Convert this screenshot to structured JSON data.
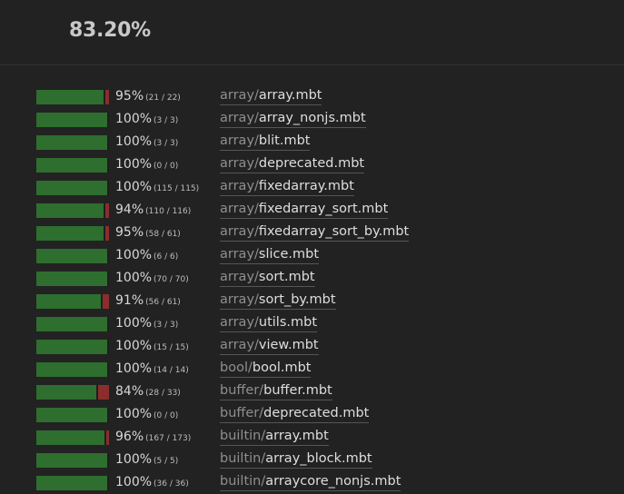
{
  "summary": {
    "total_coverage": "83.20%"
  },
  "colors": {
    "covered": "#2e6e2e",
    "uncovered": "#8b2d2d",
    "background": "#222222"
  },
  "files": [
    {
      "percent": "95%",
      "counts": "(21 / 22)",
      "dir": "array/",
      "name": "array.mbt",
      "fraction": 0.955
    },
    {
      "percent": "100%",
      "counts": "(3 / 3)",
      "dir": "array/",
      "name": "array_nonjs.mbt",
      "fraction": 1
    },
    {
      "percent": "100%",
      "counts": "(3 / 3)",
      "dir": "array/",
      "name": "blit.mbt",
      "fraction": 1
    },
    {
      "percent": "100%",
      "counts": "(0 / 0)",
      "dir": "array/",
      "name": "deprecated.mbt",
      "fraction": 1
    },
    {
      "percent": "100%",
      "counts": "(115 / 115)",
      "dir": "array/",
      "name": "fixedarray.mbt",
      "fraction": 1
    },
    {
      "percent": "94%",
      "counts": "(110 / 116)",
      "dir": "array/",
      "name": "fixedarray_sort.mbt",
      "fraction": 0.948
    },
    {
      "percent": "95%",
      "counts": "(58 / 61)",
      "dir": "array/",
      "name": "fixedarray_sort_by.mbt",
      "fraction": 0.951
    },
    {
      "percent": "100%",
      "counts": "(6 / 6)",
      "dir": "array/",
      "name": "slice.mbt",
      "fraction": 1
    },
    {
      "percent": "100%",
      "counts": "(70 / 70)",
      "dir": "array/",
      "name": "sort.mbt",
      "fraction": 1
    },
    {
      "percent": "91%",
      "counts": "(56 / 61)",
      "dir": "array/",
      "name": "sort_by.mbt",
      "fraction": 0.918
    },
    {
      "percent": "100%",
      "counts": "(3 / 3)",
      "dir": "array/",
      "name": "utils.mbt",
      "fraction": 1
    },
    {
      "percent": "100%",
      "counts": "(15 / 15)",
      "dir": "array/",
      "name": "view.mbt",
      "fraction": 1
    },
    {
      "percent": "100%",
      "counts": "(14 / 14)",
      "dir": "bool/",
      "name": "bool.mbt",
      "fraction": 1
    },
    {
      "percent": "84%",
      "counts": "(28 / 33)",
      "dir": "buffer/",
      "name": "buffer.mbt",
      "fraction": 0.848
    },
    {
      "percent": "100%",
      "counts": "(0 / 0)",
      "dir": "buffer/",
      "name": "deprecated.mbt",
      "fraction": 1
    },
    {
      "percent": "96%",
      "counts": "(167 / 173)",
      "dir": "builtin/",
      "name": "array.mbt",
      "fraction": 0.965
    },
    {
      "percent": "100%",
      "counts": "(5 / 5)",
      "dir": "builtin/",
      "name": "array_block.mbt",
      "fraction": 1
    },
    {
      "percent": "100%",
      "counts": "(36 / 36)",
      "dir": "builtin/",
      "name": "arraycore_nonjs.mbt",
      "fraction": 1
    }
  ]
}
